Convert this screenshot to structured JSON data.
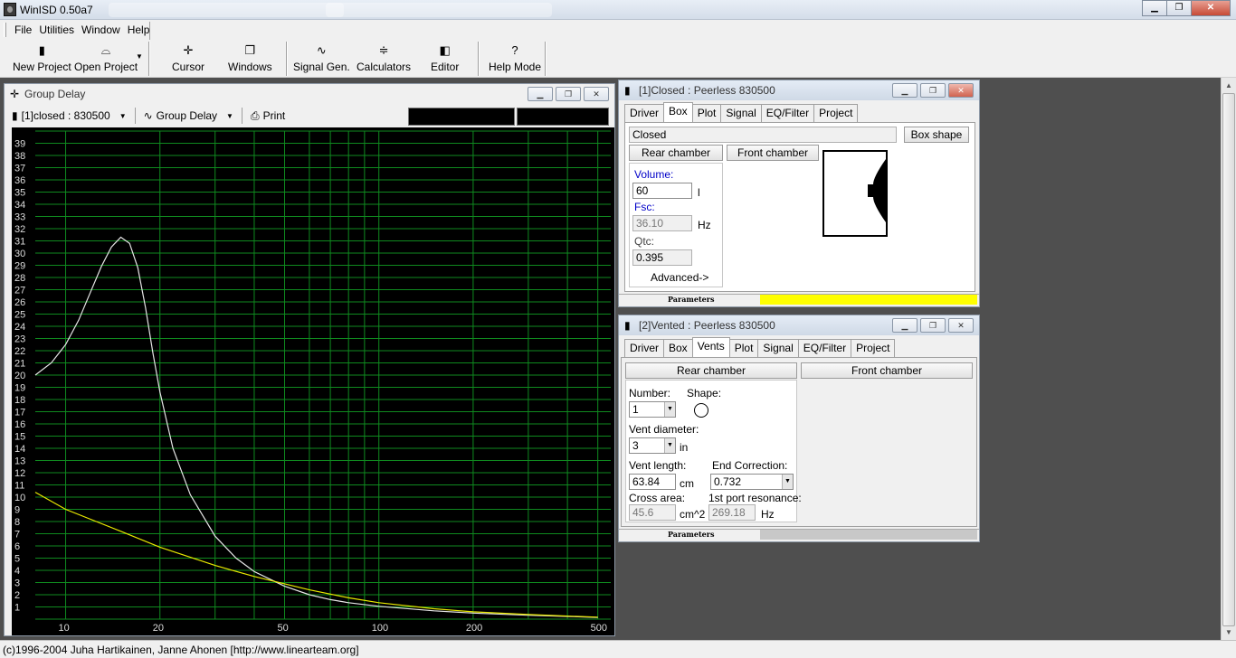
{
  "app": {
    "title": "WinISD 0.50a7"
  },
  "menu": [
    "File",
    "Utilities",
    "Window",
    "Help"
  ],
  "toolbar": {
    "new_project": "New Project",
    "open_project": "Open Project",
    "cursor": "Cursor",
    "windows": "Windows",
    "signal_gen": "Signal Gen.",
    "calculators": "Calculators",
    "editor": "Editor",
    "help_mode": "Help Mode"
  },
  "group_delay": {
    "title": "Group Delay",
    "project_select": "[1]closed : 830500",
    "plot_select": "Group Delay",
    "print": "Print"
  },
  "chart_data": {
    "type": "line",
    "x_scale": "log",
    "xlim": [
      8,
      550
    ],
    "ylim": [
      0,
      40
    ],
    "x_ticks": [
      10,
      20,
      50,
      100,
      200,
      500
    ],
    "y_ticks": [
      1,
      2,
      3,
      4,
      5,
      6,
      7,
      8,
      9,
      10,
      11,
      12,
      13,
      14,
      15,
      16,
      17,
      18,
      19,
      20,
      21,
      22,
      23,
      24,
      25,
      26,
      27,
      28,
      29,
      30,
      31,
      32,
      33,
      34,
      35,
      36,
      37,
      38,
      39
    ],
    "grid": true,
    "series": [
      {
        "color": "#e6e6e6",
        "x": [
          8,
          9,
          10,
          11,
          12,
          13,
          14,
          15,
          16,
          17,
          18,
          19,
          20,
          22,
          25,
          30,
          35,
          40,
          50,
          60,
          70,
          80,
          100,
          150,
          200,
          300,
          400,
          500
        ],
        "y": [
          20,
          21,
          22.5,
          24.5,
          26.8,
          28.9,
          30.5,
          31.3,
          30.8,
          28.8,
          25.5,
          21.8,
          18.6,
          14.0,
          10.2,
          6.8,
          5.0,
          3.9,
          2.7,
          2.0,
          1.6,
          1.35,
          1.05,
          0.68,
          0.5,
          0.32,
          0.22,
          0.14
        ]
      },
      {
        "color": "#e8e800",
        "x": [
          8,
          10,
          15,
          20,
          30,
          40,
          50,
          60,
          80,
          100,
          150,
          200,
          300,
          400,
          500
        ],
        "y": [
          10.4,
          9.0,
          7.2,
          5.9,
          4.4,
          3.5,
          2.9,
          2.4,
          1.75,
          1.35,
          0.85,
          0.6,
          0.38,
          0.25,
          0.16
        ]
      }
    ]
  },
  "closed_win": {
    "title": "[1]Closed : Peerless 830500",
    "tabs": [
      "Driver",
      "Box",
      "Plot",
      "Signal",
      "EQ/Filter",
      "Project"
    ],
    "active_tab": "Box",
    "box_type": "Closed",
    "box_shape_btn": "Box shape",
    "rear_chamber": "Rear chamber",
    "front_chamber": "Front chamber",
    "volume_label": "Volume:",
    "volume_value": "60",
    "volume_unit": "l",
    "fsc_label": "Fsc:",
    "fsc_value": "36.10",
    "fsc_unit": "Hz",
    "qtc_label": "Qtc:",
    "qtc_value": "0.395",
    "advanced": "Advanced->",
    "status": "Parameters",
    "status_color": "#ffff00"
  },
  "vented_win": {
    "title": "[2]Vented : Peerless 830500",
    "tabs": [
      "Driver",
      "Box",
      "Vents",
      "Plot",
      "Signal",
      "EQ/Filter",
      "Project"
    ],
    "active_tab": "Vents",
    "rear_chamber": "Rear chamber",
    "front_chamber": "Front chamber",
    "number_label": "Number:",
    "number_value": "1",
    "shape_label": "Shape:",
    "vent_diameter_label": "Vent diameter:",
    "vent_diameter_value": "3",
    "vent_diameter_unit": "in",
    "vent_length_label": "Vent length:",
    "vent_length_value": "63.84",
    "vent_length_unit": "cm",
    "end_correction_label": "End Correction:",
    "end_correction_value": "0.732",
    "cross_area_label": "Cross area:",
    "cross_area_value": "45.6",
    "cross_area_unit": "cm^2",
    "port_res_label": "1st port resonance:",
    "port_res_value": "269.18",
    "port_res_unit": "Hz",
    "status": "Parameters"
  },
  "statusbar": {
    "text": "(c)1996-2004 Juha Hartikainen, Janne Ahonen [http://www.linearteam.org]"
  }
}
